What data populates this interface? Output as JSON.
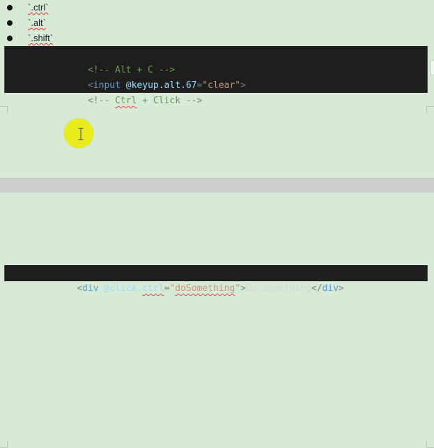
{
  "document": {
    "bullets": [
      "`.ctrl`",
      "`.alt`",
      "`.shift`"
    ],
    "code_block_1": {
      "line_1": {
        "comment": "<!-- Alt + C -->"
      },
      "line_2": {
        "open": "<",
        "tag": "input",
        "space": " ",
        "attr": "@keyup.alt.67",
        "eq": "=",
        "value": "\"clear\"",
        "close": ">"
      },
      "line_3": {
        "comment_start": "<!-- ",
        "ctrl": "Ctrl",
        "comment_end": " + Click -->"
      }
    },
    "code_block_2": {
      "open": "<",
      "tag": "div",
      "space": " ",
      "attr_start": "@click.",
      "attr_ctrl": "ctrl",
      "eq": "=",
      "value_quote_start": "\"",
      "value": "doSomething",
      "value_quote_end": "\"",
      "close": ">",
      "text": "Do something",
      "close_tag_open": "</",
      "close_tag": "div",
      "close_tag_end": ">"
    }
  }
}
